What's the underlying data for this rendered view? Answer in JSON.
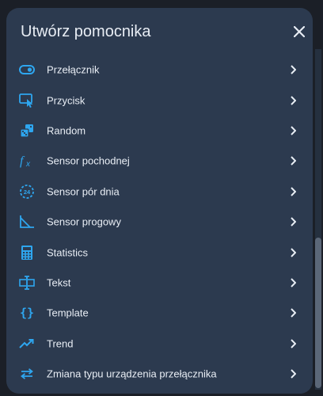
{
  "dialog": {
    "title": "Utwórz pomocnika"
  },
  "items": [
    {
      "label": "Przełącznik",
      "icon": "toggle-switch-icon"
    },
    {
      "label": "Przycisk",
      "icon": "button-pointer-icon"
    },
    {
      "label": "Random",
      "icon": "dice-icon"
    },
    {
      "label": "Sensor pochodnej",
      "icon": "function-icon"
    },
    {
      "label": "Sensor pór dnia",
      "icon": "clock-24h-icon"
    },
    {
      "label": "Sensor progowy",
      "icon": "threshold-icon"
    },
    {
      "label": "Statistics",
      "icon": "calculator-icon"
    },
    {
      "label": "Tekst",
      "icon": "text-input-icon"
    },
    {
      "label": "Template",
      "icon": "braces-icon"
    },
    {
      "label": "Trend",
      "icon": "trend-icon"
    },
    {
      "label": "Zmiana typu urządzenia przełącznika",
      "icon": "swap-arrows-icon"
    }
  ],
  "colors": {
    "accent": "#2ea6ef",
    "background": "#2c3a4f",
    "text": "#e9eef5"
  }
}
